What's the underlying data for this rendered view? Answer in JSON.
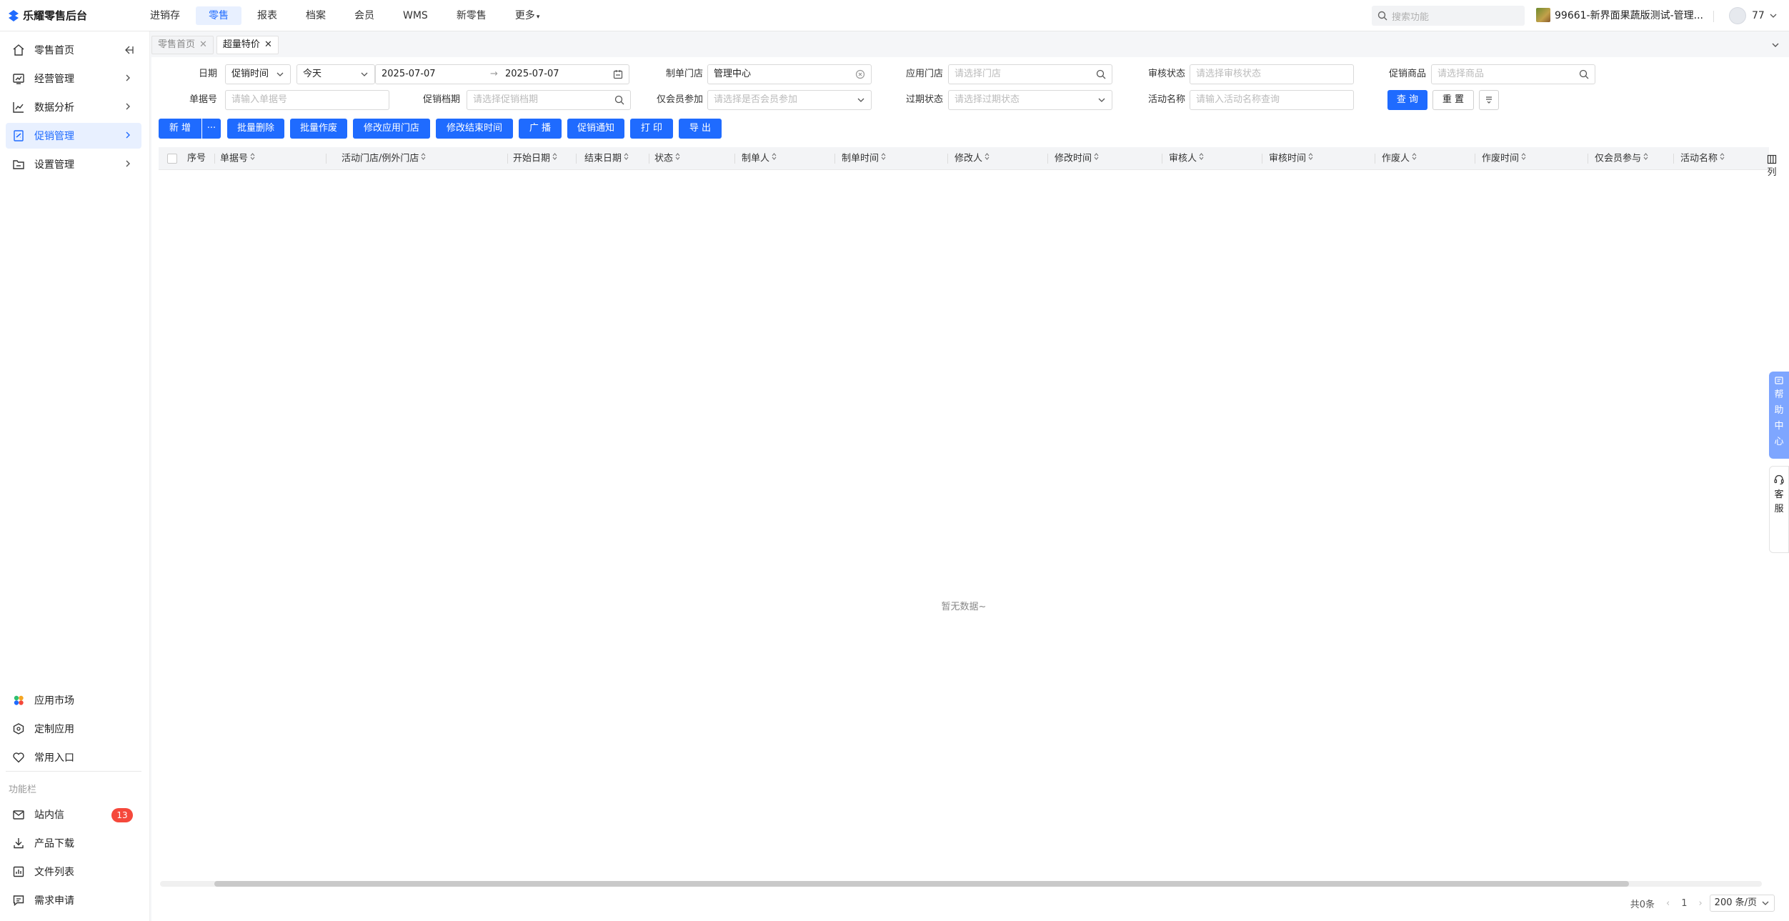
{
  "app": {
    "title": "乐耀零售后台"
  },
  "topnav": {
    "items": [
      "进销存",
      "零售",
      "报表",
      "档案",
      "会员",
      "WMS",
      "新零售",
      "更多"
    ],
    "active_index": 1
  },
  "search": {
    "placeholder": "搜索功能"
  },
  "org": {
    "name": "99661-新界面果蔬版测试-管理..."
  },
  "user": {
    "name": "77"
  },
  "sidebar": {
    "items": [
      {
        "label": "零售首页",
        "icon": "home-icon"
      },
      {
        "label": "经营管理",
        "icon": "chart-board-icon"
      },
      {
        "label": "数据分析",
        "icon": "line-chart-icon"
      },
      {
        "label": "促销管理",
        "icon": "promotion-icon"
      },
      {
        "label": "设置管理",
        "icon": "folder-icon"
      }
    ],
    "active_index": 3,
    "bottom_items": [
      {
        "label": "应用市场",
        "icon": "app-market-icon"
      },
      {
        "label": "定制应用",
        "icon": "cube-icon"
      },
      {
        "label": "常用入口",
        "icon": "heart-icon"
      }
    ],
    "section_label": "功能栏",
    "func_items": [
      {
        "label": "站内信",
        "icon": "mail-icon",
        "badge": "13"
      },
      {
        "label": "产品下载",
        "icon": "download-icon"
      },
      {
        "label": "文件列表",
        "icon": "file-list-icon"
      },
      {
        "label": "需求申请",
        "icon": "request-icon"
      }
    ]
  },
  "page_tabs": [
    {
      "label": "零售首页",
      "active": false
    },
    {
      "label": "超量特价",
      "active": true
    }
  ],
  "filters": {
    "date_label": "日期",
    "date_type": "促销时间",
    "date_range_preset": "今天",
    "date_start": "2025-07-07",
    "date_sep": "→",
    "date_end": "2025-07-07",
    "maker_store_label": "制单门店",
    "maker_store_value": "管理中心",
    "apply_store_label": "应用门店",
    "apply_store_placeholder": "请选择门店",
    "audit_status_label": "审核状态",
    "audit_status_placeholder": "请选择审核状态",
    "promo_goods_label": "促销商品",
    "promo_goods_placeholder": "请选择商品",
    "doc_no_label": "单据号",
    "doc_no_placeholder": "请输入单据号",
    "promo_schedule_label": "促销档期",
    "promo_schedule_placeholder": "请选择促销档期",
    "member_only_label": "仅会员参加",
    "member_only_placeholder": "请选择是否会员参加",
    "expire_status_label": "过期状态",
    "expire_status_placeholder": "请选择过期状态",
    "activity_name_label": "活动名称",
    "activity_name_placeholder": "请输入活动名称查询",
    "query_button": "查 询",
    "reset_button": "重 置"
  },
  "toolbar": {
    "add": "新 增",
    "more": "···",
    "batch_delete": "批量删除",
    "batch_void": "批量作废",
    "modify_store": "修改应用门店",
    "modify_end_time": "修改结束时间",
    "broadcast": "广 播",
    "promo_notice": "促销通知",
    "print": "打 印",
    "export": "导 出"
  },
  "table": {
    "columns": [
      "序号",
      "单据号",
      "活动门店/例外门店",
      "开始日期",
      "结束日期",
      "状态",
      "制单人",
      "制单时间",
      "修改人",
      "修改时间",
      "审核人",
      "审核时间",
      "作废人",
      "作废时间",
      "仅会员参与",
      "活动名称"
    ],
    "rows": [],
    "empty_text": "暂无数据~"
  },
  "column_setting": {
    "label": "列"
  },
  "pagination": {
    "total": "共0条",
    "current_page": "1",
    "page_size": "200 条/页"
  },
  "help_center": {
    "label": [
      "帮",
      "助",
      "中",
      "心"
    ]
  },
  "customer_service": {
    "label": [
      "客",
      "服"
    ]
  },
  "colors": {
    "accent": "#1f6bff",
    "accent_light": "#e8f0ff",
    "badge": "#f5483b",
    "help": "#7ea6ff"
  }
}
